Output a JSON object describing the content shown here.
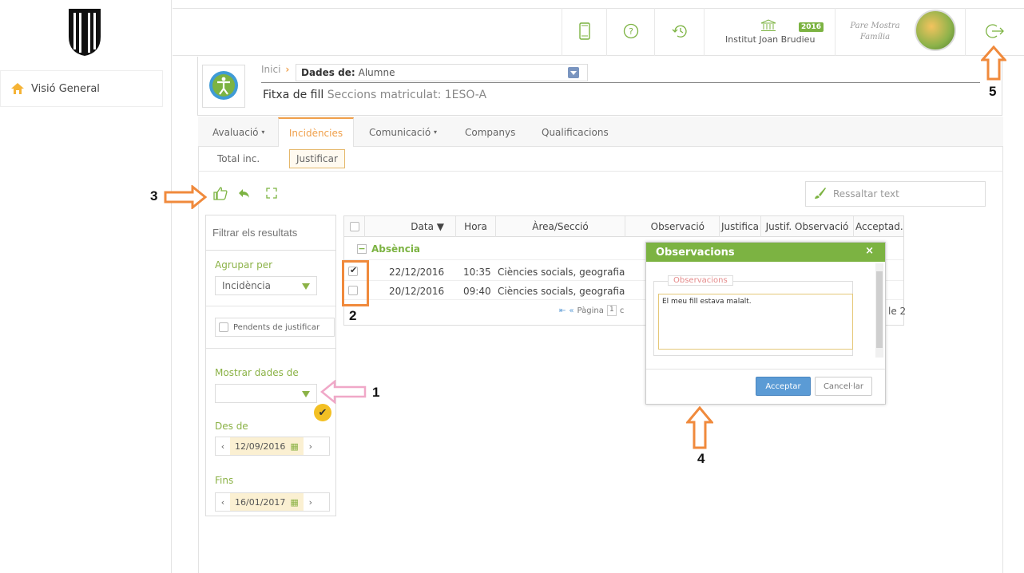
{
  "sidebar": {
    "nav_home": "Visió General"
  },
  "topbar": {
    "year": "2016",
    "school": "Institut Joan Brudieu",
    "user_name": "Pare Mostra",
    "user_role": "Família"
  },
  "header": {
    "breadcrumb_home": "Inici",
    "dades_label": "Dades de:",
    "dades_value": "Alumne",
    "fitxa_title": "Fitxa de fill",
    "fitxa_sub": "Seccions matriculat: 1ESO-A"
  },
  "tabs": [
    "Avaluació",
    "Incidències",
    "Comunicació",
    "Companys",
    "Qualificacions"
  ],
  "subtabs": [
    "Total inc.",
    "Justificar"
  ],
  "highlight_placeholder": "Ressaltar text",
  "filter": {
    "search_placeholder": "Filtrar els resultats",
    "group_label": "Agrupar per",
    "group_value": "Incidència",
    "pending_label": "Pendents de justificar",
    "show_label": "Mostrar dades de",
    "from_label": "Des de",
    "from_date": "12/09/2016",
    "to_label": "Fins",
    "to_date": "16/01/2017"
  },
  "grid": {
    "columns": [
      "Data ▼",
      "Hora",
      "Àrea/Secció",
      "Observació",
      "Justifica",
      "Justif. Observació",
      "Acceptad."
    ],
    "group": "Absència",
    "rows": [
      {
        "date": "22/12/2016",
        "time": "10:35",
        "area": "Ciències socials, geografia",
        "checked": true
      },
      {
        "date": "20/12/2016",
        "time": "09:40",
        "area": "Ciències socials, geografia",
        "checked": false
      }
    ],
    "pager_label": "Pàgina",
    "pager_page": "1",
    "pager_of": "c",
    "pager_total": "le 2"
  },
  "dialog": {
    "title": "Observacions",
    "close": "×",
    "legend": "Observacions",
    "text": "El meu fill estava malalt.",
    "ok": "Acceptar",
    "cancel": "Cancel·lar"
  },
  "markers": {
    "m1": "1",
    "m2": "2",
    "m3": "3",
    "m4": "4",
    "m5": "5"
  },
  "colors": {
    "accent_green": "#7cb342",
    "accent_orange": "#f08a3c",
    "marker_pink": "#f0a8c8"
  }
}
